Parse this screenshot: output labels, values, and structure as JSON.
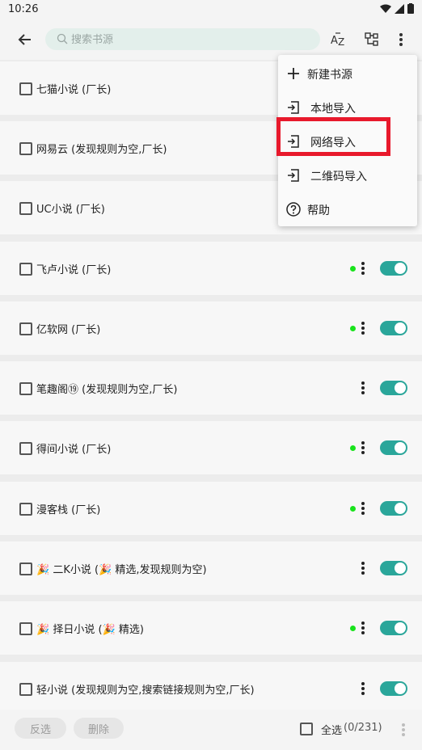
{
  "status": {
    "time": "10:26"
  },
  "toolbar": {
    "search_placeholder": "搜索书源",
    "sort_icon_text": "A",
    "sort_icon_text2": "Z"
  },
  "sources": [
    {
      "name": "七猫小说 (厂长)",
      "dot": true
    },
    {
      "name": "网易云 (发现规则为空,厂长)",
      "dot": false
    },
    {
      "name": "UC小说 (厂长)",
      "dot": false
    },
    {
      "name": "飞卢小说 (厂长)",
      "dot": true
    },
    {
      "name": "亿软网 (厂长)",
      "dot": true
    },
    {
      "name": "笔趣阁⑲ (发现规则为空,厂长)",
      "dot": false
    },
    {
      "name": "得间小说 (厂长)",
      "dot": true
    },
    {
      "name": "漫客栈 (厂长)",
      "dot": true
    },
    {
      "name": "🎉 二K小说 (🎉 精选,发现规则为空)",
      "dot": false
    },
    {
      "name": "🎉 择日小说 (🎉 精选)",
      "dot": true
    },
    {
      "name": "轻小说 (发现规则为空,搜索链接规则为空,厂长)",
      "dot": false
    }
  ],
  "bottom": {
    "invert_label": "反选",
    "delete_label": "删除",
    "select_all_label": "全选",
    "count_label": "(0/231)"
  },
  "menu": {
    "items": [
      {
        "label": "新建书源",
        "icon": "plus-icon"
      },
      {
        "label": "本地导入",
        "icon": "import-icon"
      },
      {
        "label": "网络导入",
        "icon": "import-icon"
      },
      {
        "label": "二维码导入",
        "icon": "import-icon"
      },
      {
        "label": "帮助",
        "icon": "help-icon"
      }
    ]
  },
  "colors": {
    "accent": "#2aa69a",
    "dot": "#19e31c",
    "highlight": "#e8192c"
  }
}
